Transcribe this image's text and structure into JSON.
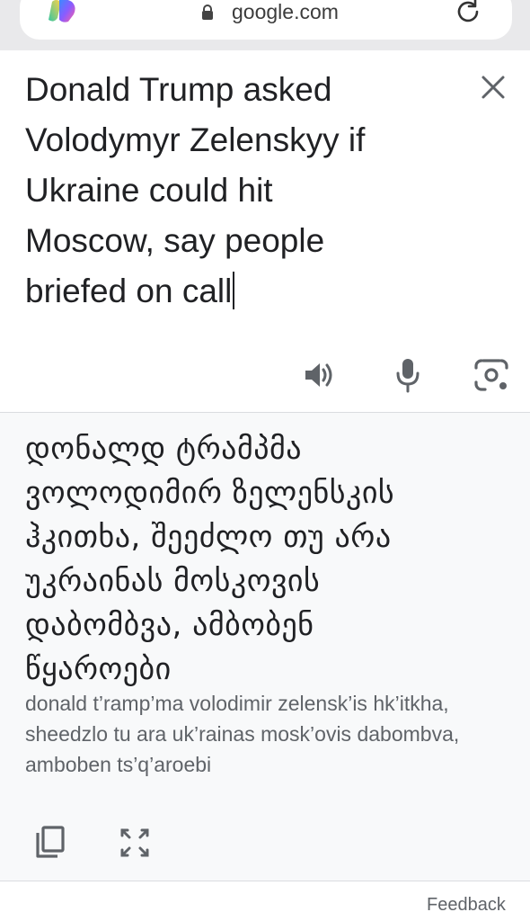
{
  "browser": {
    "url": "google.com",
    "icons": [
      "copilot-icon",
      "lock-icon",
      "reload-icon"
    ]
  },
  "source": {
    "text": "Donald Trump asked\nVolodymyr Zelenskyy if\nUkraine could hit\nMoscow, say people\nbriefed on call",
    "icons": [
      "close-icon",
      "speaker-icon",
      "mic-icon",
      "lens-icon"
    ]
  },
  "translation": {
    "lines": [
      "დონალდ ტრამპმა",
      "ვოლოდიმირ ზელენსკის",
      "ჰკითხა, შეეძლო თუ არა",
      "უკრაინას მოსკოვის",
      "დაბომბვა, ამბობენ",
      "წყაროები"
    ],
    "transliteration": "donald t’ramp’ma volodimir zelensk’is hk’itkha, sheedzlo tu ara uk’rainas mosk’ovis dabombva, amboben ts’q’aroebi",
    "icons": [
      "copy-icon",
      "expand-icon"
    ]
  },
  "footer": {
    "feedback_label": "Feedback"
  },
  "colors": {
    "topbar": "#e9e9eb",
    "panel": "#f8f9fa",
    "secondary_text": "#5f6368",
    "icon": "#5f6368"
  }
}
